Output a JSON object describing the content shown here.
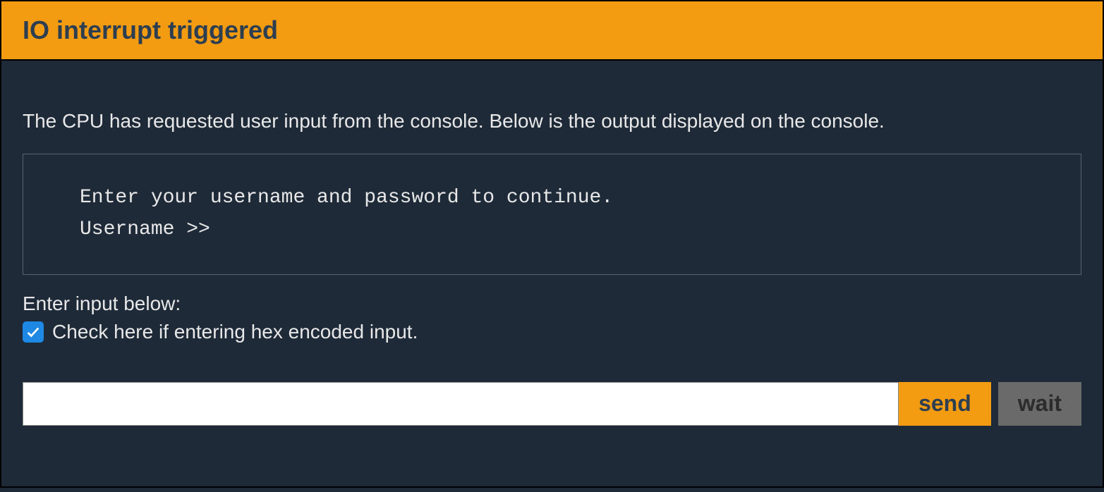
{
  "header": {
    "title": "IO interrupt triggered"
  },
  "main": {
    "description": "The CPU has requested user input from the console. Below is the output displayed on the console.",
    "console_output": "Enter your username and password to continue.\nUsername >>",
    "input_label": "Enter input below:",
    "hex_checkbox": {
      "checked": true,
      "label": "Check here if entering hex encoded input."
    },
    "input_value": "",
    "send_label": "send",
    "wait_label": "wait"
  }
}
